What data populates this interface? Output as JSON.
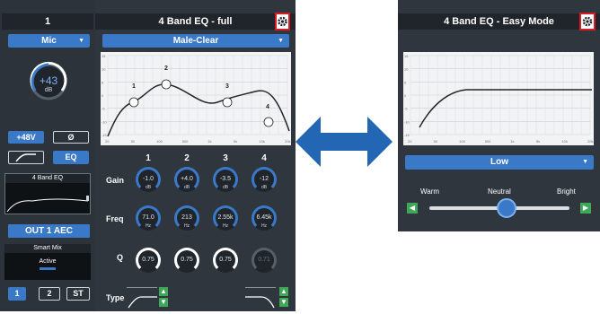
{
  "left_panel": {
    "channel_title": "1",
    "input_select": "Mic",
    "gain_value": "+43",
    "gain_unit": "dB",
    "phantom_button": "+48V",
    "phase_button": "Ø",
    "eq_button": "EQ",
    "eq_preview_title": "4 Band EQ",
    "out_button": "OUT 1 AEC",
    "smart_mix_title": "Smart Mix",
    "smart_mix_status": "Active",
    "bottom_buttons": [
      "1",
      "2",
      "ST"
    ]
  },
  "full_eq": {
    "title": "4 Band EQ - full",
    "preset": "Male-Clear",
    "graph_points": [
      "1",
      "2",
      "3",
      "4"
    ],
    "y_ticks": [
      "15",
      "10",
      "5",
      "0",
      "-5",
      "-10",
      "-15"
    ],
    "x_ticks": [
      "20",
      "50",
      "100",
      "500",
      "1k",
      "5k",
      "10k",
      "20k"
    ],
    "band_headers": [
      "1",
      "2",
      "3",
      "4"
    ],
    "row_labels": {
      "gain": "Gain",
      "freq": "Freq",
      "q": "Q",
      "type": "Type"
    },
    "gain_values": [
      "-1.0",
      "+4.0",
      "-3.5",
      "-12"
    ],
    "gain_unit": "dB",
    "freq_values": [
      "71.0",
      "213",
      "2.55k",
      "6.45k"
    ],
    "freq_unit": "Hz",
    "q_values": [
      "0.75",
      "0.75",
      "0.75",
      "0.71"
    ]
  },
  "easy_eq": {
    "title": "4 Band EQ - Easy Mode",
    "mode": "Low",
    "y_ticks": [
      "15",
      "10",
      "5",
      "0",
      "-5",
      "-10",
      "-15"
    ],
    "x_ticks": [
      "20",
      "50",
      "100",
      "500",
      "1k",
      "5k",
      "10k",
      "20k"
    ],
    "slider_labels": {
      "warm": "Warm",
      "neutral": "Neutral",
      "bright": "Bright"
    },
    "slider_level": 0.55
  },
  "colors": {
    "accent": "#3a78c8",
    "panel": "#2c333b",
    "arrow": "#2366b3",
    "highlight": "#d61b23"
  }
}
